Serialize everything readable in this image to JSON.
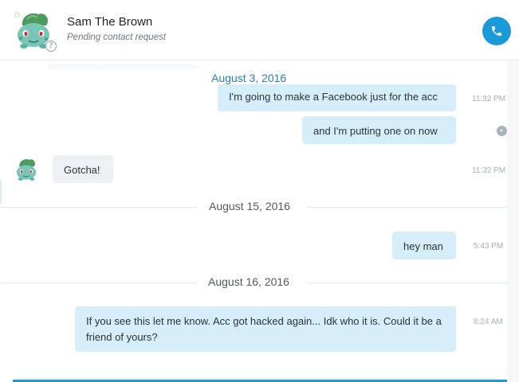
{
  "header": {
    "contact_name": "Sam The Brown",
    "contact_status": "Pending contact request",
    "presence_symbol": "?",
    "favorite_symbol": "✩",
    "call_icon": "phone-icon",
    "accent_color": "#1a9ad9"
  },
  "conversation": {
    "sticky_date": "August 3, 2016",
    "messages": [
      {
        "direction": "outgoing",
        "text": "I'm going to make a Facebook just for the acc",
        "time": "11:32 PM"
      },
      {
        "direction": "outgoing",
        "text": "and I'm putting one on now",
        "time": ""
      },
      {
        "direction": "incoming",
        "text": "Gotcha!",
        "time": "11:32 PM"
      }
    ],
    "date_aug15": "August 15, 2016",
    "messages_aug15": [
      {
        "direction": "outgoing",
        "text": "hey man",
        "time": "5:43 PM"
      }
    ],
    "date_aug16": "August 16, 2016",
    "messages_aug16": [
      {
        "direction": "outgoing",
        "text": "If you see this let me know. Acc got hacked again... Idk who it is. Could it be a friend of yours?",
        "time": "8:24 AM"
      }
    ]
  }
}
